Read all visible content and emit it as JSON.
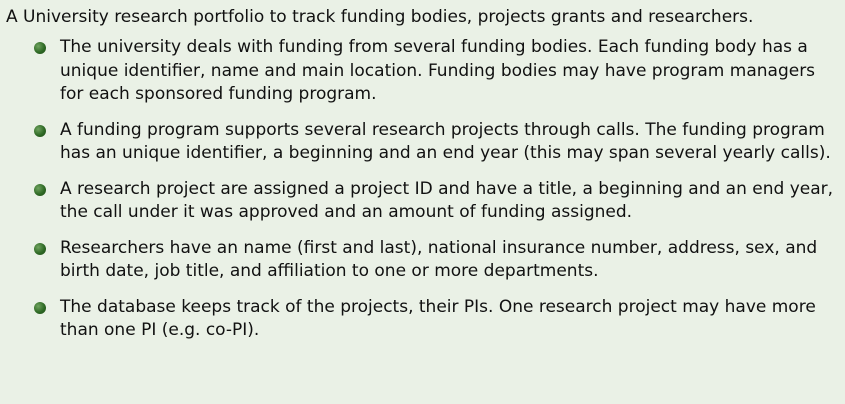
{
  "intro": "A University research portfolio to track funding bodies, projects grants and researchers.",
  "bullets": [
    "The university deals with funding from several funding bodies. Each funding body has a unique identifier, name and main location. Funding bodies may have program managers for each sponsored funding program.",
    "A funding program supports several research projects through calls. The funding program has an unique identifier, a beginning and an end year (this may span several yearly calls).",
    "A research project are assigned a project ID and have a title, a beginning and an end year, the call under it was approved and an amount of funding assigned.",
    "Researchers have an name (first and last), national insurance number, address, sex, and birth date, job title, and affiliation to one or more departments.",
    "The database keeps track of the projects, their PIs. One research project may have more than one PI (e.g. co-PI)."
  ],
  "colors": {
    "background": "#eaf1e6",
    "bullet": "#2f6a25",
    "text": "#111111"
  },
  "icons": {
    "bullet": "green-ball-bullet-icon"
  }
}
